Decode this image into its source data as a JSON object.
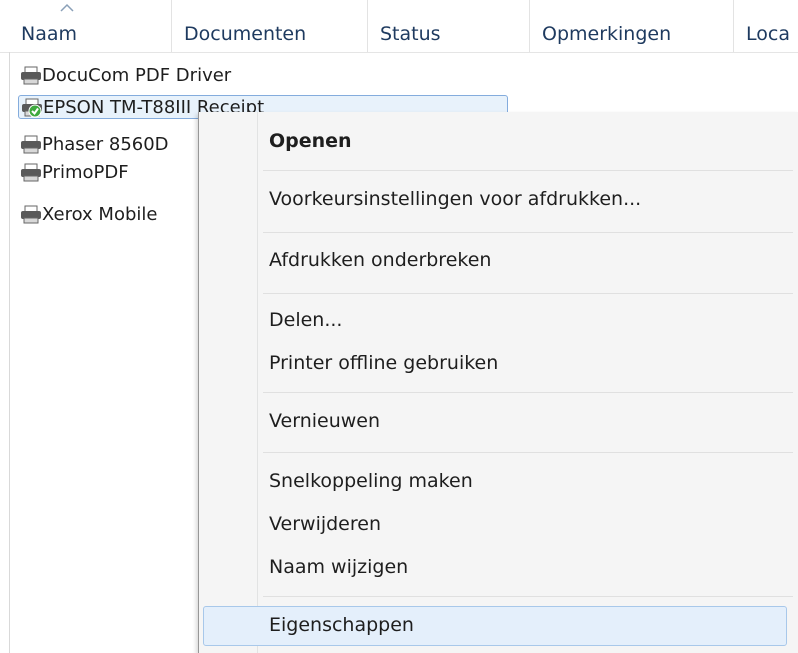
{
  "columns": [
    {
      "label": "Naam"
    },
    {
      "label": "Documenten"
    },
    {
      "label": "Status"
    },
    {
      "label": "Opmerkingen"
    },
    {
      "label": "Loca"
    }
  ],
  "printers": [
    {
      "name": "DocuCom PDF Driver",
      "icon": "printer-icon"
    },
    {
      "name": "EPSON TM-T88III Receipt",
      "icon": "default-printer-icon",
      "selected": true
    },
    {
      "name": "Phaser 8560D",
      "icon": "printer-icon"
    },
    {
      "name": "PrimoPDF",
      "icon": "printer-icon"
    },
    {
      "name": "Xerox Mobile",
      "icon": "printer-icon"
    }
  ],
  "context_menu": {
    "items": [
      {
        "label": "Openen",
        "bold": true
      },
      {
        "label": "Voorkeursinstellingen voor afdrukken..."
      },
      {
        "label": "Afdrukken onderbreken"
      },
      {
        "label": "Delen..."
      },
      {
        "label": "Printer offline gebruiken"
      },
      {
        "label": "Vernieuwen"
      },
      {
        "label": "Snelkoppeling maken"
      },
      {
        "label": "Verwijderen"
      },
      {
        "label": "Naam wijzigen"
      },
      {
        "label": "Eigenschappen",
        "highlighted": true
      }
    ]
  },
  "colors": {
    "selection_bg": "#e8f2fb",
    "selection_border": "#84acdd",
    "menu_bg": "#f5f5f5",
    "header_text": "#1e3a5f"
  }
}
